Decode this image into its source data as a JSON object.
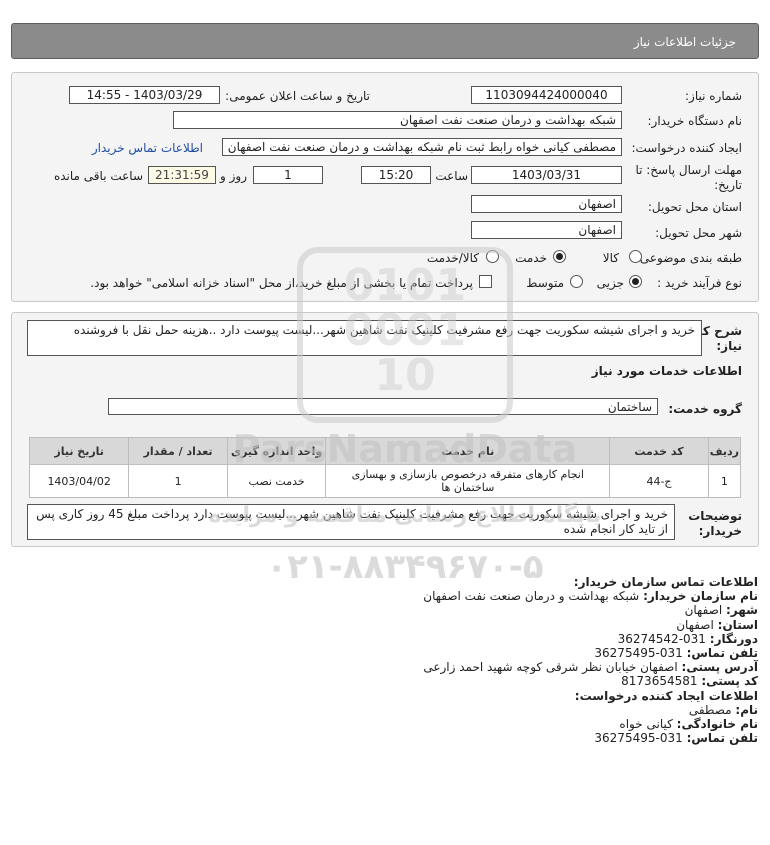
{
  "page_title": "جزئیات اطلاعات نیاز",
  "form": {
    "need_number_label": "شماره نیاز:",
    "need_number": "1103094424000040",
    "announce_label": "تاریخ و ساعت اعلان عمومی:",
    "announce_value": "1403/03/29 - 14:55",
    "buyer_org_label": "نام دستگاه خریدار:",
    "buyer_org": "شبکه بهداشت و درمان صنعت نفت اصفهان",
    "creator_label": "ایجاد کننده درخواست:",
    "creator": "مصطفی کیانی خواه رابط ثبت نام شبکه بهداشت و درمان صنعت نفت اصفهان",
    "contact_link": "اطلاعات تماس خریدار",
    "deadline_label_1": "مهلت ارسال پاسخ: تا",
    "deadline_label_2": "تاریخ:",
    "deadline_date": "1403/03/31",
    "time_label": "ساعت",
    "deadline_time": "15:20",
    "days_value": "1",
    "days_label": "روز و",
    "remaining_time": "21:31:59",
    "remaining_label": "ساعت باقی مانده",
    "province_label": "استان محل تحویل:",
    "province": "اصفهان",
    "city_label": "شهر محل تحویل:",
    "city": "اصفهان",
    "category_label": "طبقه بندی موضوعی:",
    "category_options": [
      "کالا",
      "خدمت",
      "کالا/خدمت"
    ],
    "category_selected": "خدمت",
    "process_label": "نوع فرآیند خرید :",
    "process_options": [
      "جزیی",
      "متوسط"
    ],
    "process_selected": "جزیی",
    "payment_note": "پرداخت تمام یا بخشی از مبلغ خرید،از محل \"اسناد خزانه اسلامی\" خواهد بود."
  },
  "description": {
    "label_1": "شرح کلی",
    "label_2": "نیاز:",
    "text": "خرید و اجرای شیشه سکوریت جهت رفع مشرفیت کلینیک نفت شاهین شهر...لیست پیوست دارد ..هزینه حمل نقل با فروشنده"
  },
  "services": {
    "heading": "اطلاعات خدمات مورد نیاز",
    "group_label": "گروه خدمت:",
    "group_value": "ساختمان",
    "columns": [
      "ردیف",
      "کد خدمت",
      "نام خدمت",
      "واحد اندازه گیری",
      "تعداد / مقدار",
      "تاریخ نیاز"
    ],
    "rows": [
      [
        "1",
        "ج-44",
        "انجام کارهای متفرقه درخصوص بازسازی و بهسازی ساختمان ها",
        "خدمت نصب",
        "1",
        "1403/04/02"
      ]
    ]
  },
  "buyer_notes": {
    "label_1": "توضیحات",
    "label_2": "خریدار:",
    "text": "خرید و اجرای شیشه سکوریت جهت رفع مشرفیت کلینیک نفت شاهین شهر...لیست پیوست دارد پرداخت مبلغ 45 روز کاری پس از تاید کار انجام شده"
  },
  "contact": {
    "heading": "اطلاعات تماس سازمان خریدار:",
    "org_label": "نام سازمان خریدار:",
    "org": "شبکه بهداشت و درمان صنعت نفت اصفهان",
    "city_label": "شهر:",
    "city": "اصفهان",
    "province_label": "استان:",
    "province": "اصفهان",
    "fax_label": "دورنگار:",
    "fax": "031-36274542",
    "phone_label": "تلفن تماس:",
    "phone": "031-36275495",
    "address_label": "آدرس پستی:",
    "address": "اصفهان خیابان نظر شرقی کوچه شهید احمد زارعی",
    "postal_label": "کد پستی:",
    "postal": "8173654581",
    "creator_heading": "اطلاعات ایجاد کننده درخواست:",
    "name_label": "نام:",
    "name": "مصطفی",
    "family_label": "نام خانوادگی:",
    "family": "کیانی خواه",
    "creator_phone_label": "تلفن تماس:",
    "creator_phone": "031-36275495"
  },
  "watermark": {
    "brand": "ParsNamadData",
    "tagline": "پایگاه اطلاع رسانی مناقصه و مزایده",
    "phone": "۰۲۱-۸۸۳۴۹۶۷۰-۵"
  }
}
